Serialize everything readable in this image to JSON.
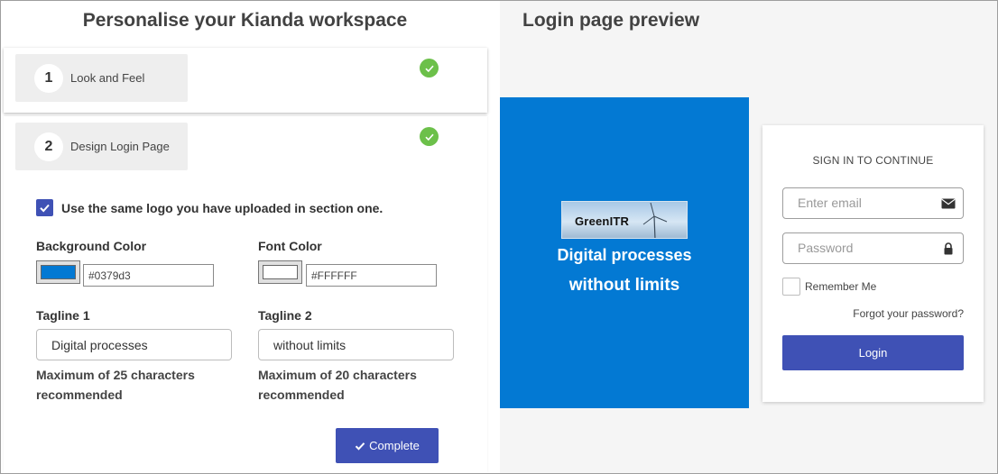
{
  "left": {
    "title": "Personalise your Kianda workspace",
    "sections": [
      {
        "number": "1",
        "label": "Look and Feel",
        "completed": true
      },
      {
        "number": "2",
        "label": "Design Login Page",
        "completed": true
      }
    ],
    "same_logo": {
      "label": "Use the same logo you have uploaded in section one.",
      "checked": true
    },
    "background_color": {
      "label": "Background Color",
      "value": "#0379d3"
    },
    "font_color": {
      "label": "Font Color",
      "value": "#FFFFFF"
    },
    "tagline1": {
      "label": "Tagline 1",
      "value": "Digital processes",
      "hint": "Maximum of 25 characters recommended"
    },
    "tagline2": {
      "label": "Tagline 2",
      "value": "without limits",
      "hint": "Maximum of 20 characters recommended"
    },
    "complete_label": "Complete"
  },
  "preview": {
    "title": "Login page preview",
    "logo_text": "GreenITR",
    "tagline1": "Digital processes",
    "tagline2": "without limits",
    "panel_color": "#0379d3",
    "login": {
      "heading": "SIGN IN TO CONTINUE",
      "email_placeholder": "Enter email",
      "password_placeholder": "Password",
      "remember_label": "Remember Me",
      "forgot_label": "Forgot your password?",
      "button_label": "Login",
      "button_color": "#3f51b5"
    }
  },
  "icons": {
    "section_check": "check-circle-icon",
    "checkbox_check": "check-icon",
    "email": "envelope-icon",
    "password": "lock-icon",
    "complete": "check-icon"
  }
}
